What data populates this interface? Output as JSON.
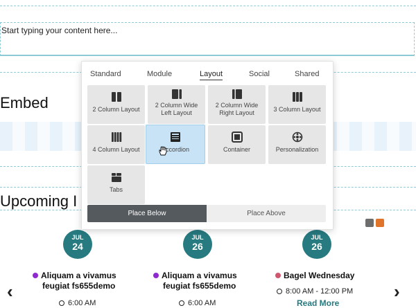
{
  "editor": {
    "placeholder_text": "Start typing your content here..."
  },
  "embed": {
    "title": "Embed"
  },
  "upcoming": {
    "title": "Upcoming I"
  },
  "popup": {
    "tabs": [
      {
        "label": "Standard",
        "active": false
      },
      {
        "label": "Module",
        "active": false
      },
      {
        "label": "Layout",
        "active": true
      },
      {
        "label": "Social",
        "active": false
      },
      {
        "label": "Shared",
        "active": false
      }
    ],
    "tiles": [
      {
        "label": "2 Column Layout",
        "icon": "two-column-icon"
      },
      {
        "label": "2 Column Wide Left Layout",
        "icon": "two-column-wide-left-icon"
      },
      {
        "label": "2 Column Wide Right Layout",
        "icon": "two-column-wide-right-icon"
      },
      {
        "label": "3 Column Layout",
        "icon": "three-column-icon"
      },
      {
        "label": "4 Column Layout",
        "icon": "four-column-icon"
      },
      {
        "label": "Accordion",
        "icon": "accordion-icon",
        "selected": true
      },
      {
        "label": "Container",
        "icon": "container-icon"
      },
      {
        "label": "Personalization",
        "icon": "personalization-icon"
      },
      {
        "label": "Tabs",
        "icon": "tabs-icon"
      }
    ],
    "place_below": "Place Below",
    "place_above": "Place Above"
  },
  "events": [
    {
      "month": "JUL",
      "day": "24",
      "title_line1": "Aliquam a vivamus",
      "title_line2": "feugiat fs655demo",
      "time": "6:00 AM",
      "dot_color": "#8e2ad0"
    },
    {
      "month": "JUL",
      "day": "26",
      "title_line1": "Aliquam a vivamus",
      "title_line2": "feugiat fs655demo",
      "time": "6:00 AM",
      "dot_color": "#8e2ad0"
    },
    {
      "month": "JUL",
      "day": "26",
      "title_line1": "Bagel Wednesday",
      "title_line2": "",
      "time": "8:00 AM - 12:00 PM",
      "dot_color": "#d0566e",
      "read_more": "Read More"
    }
  ],
  "nav": {
    "prev": "‹",
    "next": "›"
  },
  "colors": {
    "accent": "#267a80",
    "rss": "#6d6d6d",
    "notify": "#e0742a"
  }
}
